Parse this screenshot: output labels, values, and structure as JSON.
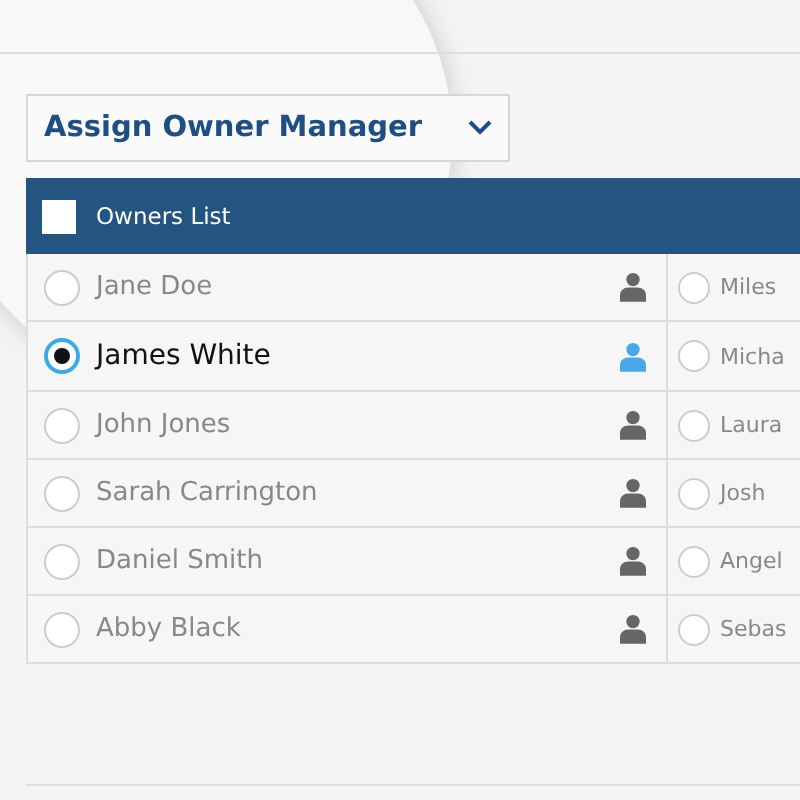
{
  "dropdown": {
    "label": "Assign Owner Manager"
  },
  "list_header": {
    "label": "Owners List",
    "checked": false
  },
  "owners": [
    {
      "name": "Jane Doe",
      "selected": false
    },
    {
      "name": "James White",
      "selected": true
    },
    {
      "name": "John Jones",
      "selected": false
    },
    {
      "name": "Sarah Carrington",
      "selected": false
    },
    {
      "name": "Daniel Smith",
      "selected": false
    },
    {
      "name": "Abby Black",
      "selected": false
    }
  ],
  "owners_column_2": [
    {
      "name": "Miles",
      "selected": false
    },
    {
      "name": "Micha",
      "selected": false
    },
    {
      "name": "Laura",
      "selected": false
    },
    {
      "name": "Josh",
      "selected": false
    },
    {
      "name": "Angel",
      "selected": false
    },
    {
      "name": "Sebas",
      "selected": false
    }
  ]
}
